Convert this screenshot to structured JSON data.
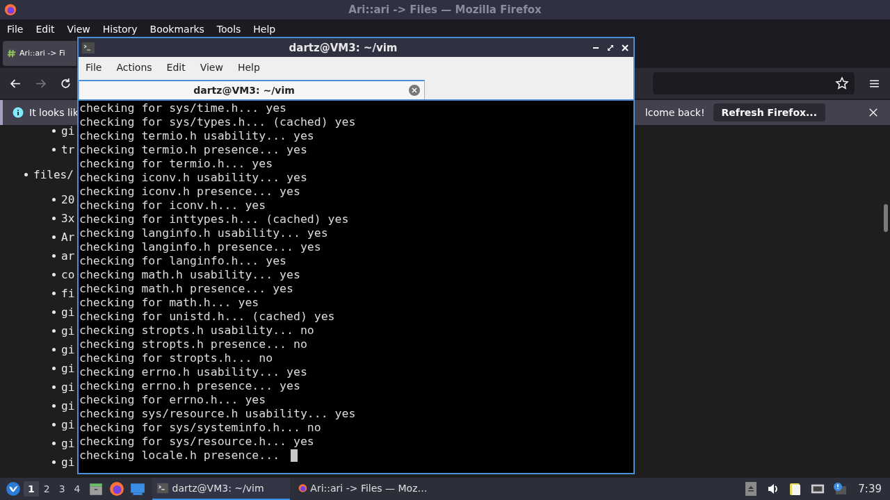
{
  "firefox": {
    "title": "Ari::ari -> Files — Mozilla Firefox",
    "menu": [
      "File",
      "Edit",
      "View",
      "History",
      "Bookmarks",
      "Tools",
      "Help"
    ],
    "tab": {
      "title": "Ari::ari -> Fi"
    },
    "notification": {
      "text_start": "It looks lik",
      "text_end": "lcome back!",
      "button": "Refresh Firefox..."
    },
    "page": {
      "items": [
        {
          "label": "gi"
        },
        {
          "label": "tr"
        },
        {
          "label": "files/",
          "children": [
            {
              "label": "20"
            },
            {
              "label": "3x"
            },
            {
              "label": "Ar"
            },
            {
              "label": "ar"
            },
            {
              "label": "co"
            },
            {
              "label": "fi"
            },
            {
              "label": "gi"
            },
            {
              "label": "gi"
            },
            {
              "label": "gi"
            },
            {
              "label": "gi"
            },
            {
              "label": "gi"
            },
            {
              "label": "gi"
            },
            {
              "label": "gi"
            },
            {
              "label": "gi"
            },
            {
              "label": "gi"
            }
          ]
        }
      ]
    }
  },
  "terminal": {
    "title": "dartz@VM3: ~/vim",
    "menu": [
      "File",
      "Actions",
      "Edit",
      "View",
      "Help"
    ],
    "tab": {
      "title": "dartz@VM3: ~/vim"
    },
    "lines": [
      "checking for sys/time.h... yes",
      "checking for sys/types.h... (cached) yes",
      "checking termio.h usability... yes",
      "checking termio.h presence... yes",
      "checking for termio.h... yes",
      "checking iconv.h usability... yes",
      "checking iconv.h presence... yes",
      "checking for iconv.h... yes",
      "checking for inttypes.h... (cached) yes",
      "checking langinfo.h usability... yes",
      "checking langinfo.h presence... yes",
      "checking for langinfo.h... yes",
      "checking math.h usability... yes",
      "checking math.h presence... yes",
      "checking for math.h... yes",
      "checking for unistd.h... (cached) yes",
      "checking stropts.h usability... no",
      "checking stropts.h presence... no",
      "checking for stropts.h... no",
      "checking errno.h usability... yes",
      "checking errno.h presence... yes",
      "checking for errno.h... yes",
      "checking sys/resource.h usability... yes",
      "checking for sys/systeminfo.h... no",
      "checking for sys/resource.h... yes",
      "checking locale.h presence... "
    ]
  },
  "taskbar": {
    "workspaces": [
      {
        "label": "1",
        "selected": true
      },
      {
        "label": "2",
        "selected": false
      },
      {
        "label": "3",
        "selected": false
      },
      {
        "label": "4",
        "selected": false
      }
    ],
    "tasks": [
      {
        "kind": "terminal",
        "label": "dartz@VM3: ~/vim",
        "selected": true
      },
      {
        "kind": "firefox",
        "label": "Ari::ari -> Files — Moz…",
        "selected": false
      }
    ],
    "clock": "7:39"
  }
}
